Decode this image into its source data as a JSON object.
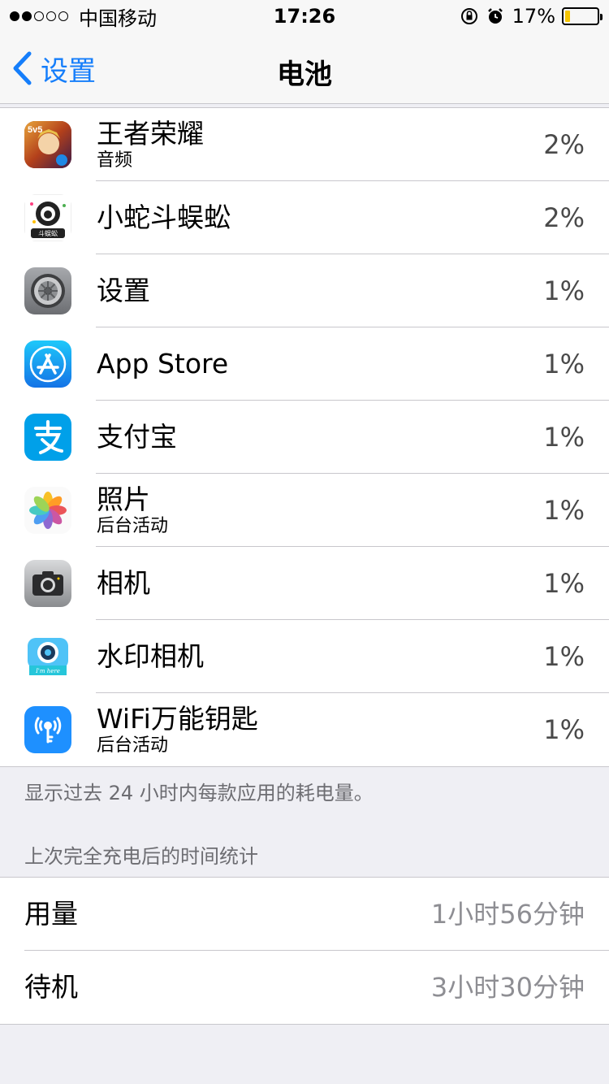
{
  "status_bar": {
    "carrier": "中国移动",
    "time": "17:26",
    "battery_percent": "17%",
    "battery_level": 0.17,
    "signal_bars": 2,
    "signal_total": 5
  },
  "nav": {
    "back_label": "设置",
    "title": "电池"
  },
  "apps": [
    {
      "name": "王者荣耀",
      "sub": "音频",
      "percent": "2%",
      "icon": "honor-of-kings-icon"
    },
    {
      "name": "小蛇斗蜈蚣",
      "sub": "",
      "percent": "2%",
      "icon": "snake-game-icon"
    },
    {
      "name": "设置",
      "sub": "",
      "percent": "1%",
      "icon": "settings-gear-icon"
    },
    {
      "name": "App Store",
      "sub": "",
      "percent": "1%",
      "icon": "app-store-icon"
    },
    {
      "name": "支付宝",
      "sub": "",
      "percent": "1%",
      "icon": "alipay-icon"
    },
    {
      "name": "照片",
      "sub": "后台活动",
      "percent": "1%",
      "icon": "photos-icon"
    },
    {
      "name": "相机",
      "sub": "",
      "percent": "1%",
      "icon": "camera-icon"
    },
    {
      "name": "水印相机",
      "sub": "",
      "percent": "1%",
      "icon": "watermark-camera-icon"
    },
    {
      "name": "WiFi万能钥匙",
      "sub": "后台活动",
      "percent": "1%",
      "icon": "wifi-key-icon"
    }
  ],
  "note": "显示过去 24 小时内每款应用的耗电量。",
  "section_header": "上次完全充电后的时间统计",
  "usage": {
    "usage_label": "用量",
    "usage_value": "1小时56分钟",
    "standby_label": "待机",
    "standby_value": "3小时30分钟"
  },
  "colors": {
    "accent": "#157efb",
    "battery_fill": "#f5c400"
  }
}
